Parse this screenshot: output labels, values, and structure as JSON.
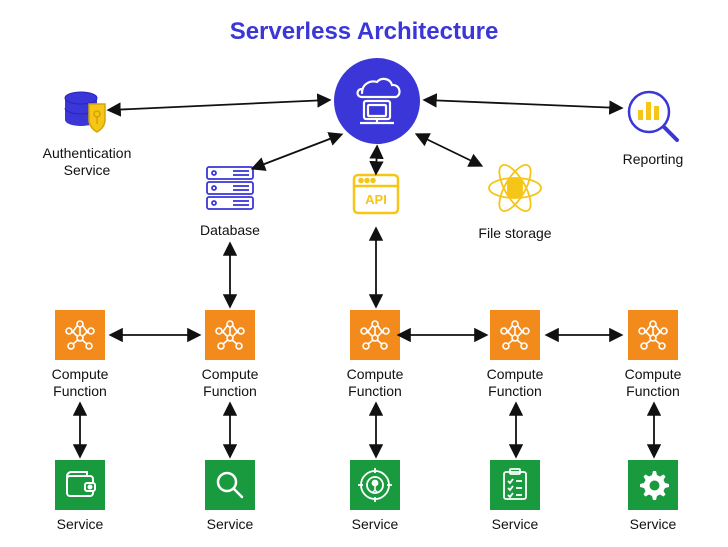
{
  "title": "Serverless Architecture",
  "nodes": {
    "auth": {
      "label": "Authentication\nService"
    },
    "database": {
      "label": "Database"
    },
    "api": {
      "label": "API"
    },
    "filestorage": {
      "label": "File storage"
    },
    "reporting": {
      "label": "Reporting"
    },
    "compute": [
      {
        "label": "Compute\nFunction"
      },
      {
        "label": "Compute\nFunction"
      },
      {
        "label": "Compute\nFunction"
      },
      {
        "label": "Compute\nFunction"
      },
      {
        "label": "Compute\nFunction"
      }
    ],
    "services": [
      {
        "label": "Service"
      },
      {
        "label": "Service"
      },
      {
        "label": "Service"
      },
      {
        "label": "Service"
      },
      {
        "label": "Service"
      }
    ]
  },
  "colors": {
    "accent": "#3a36d8",
    "orange": "#f38b1c",
    "green": "#1a9a3f",
    "yellow": "#f5c518"
  }
}
